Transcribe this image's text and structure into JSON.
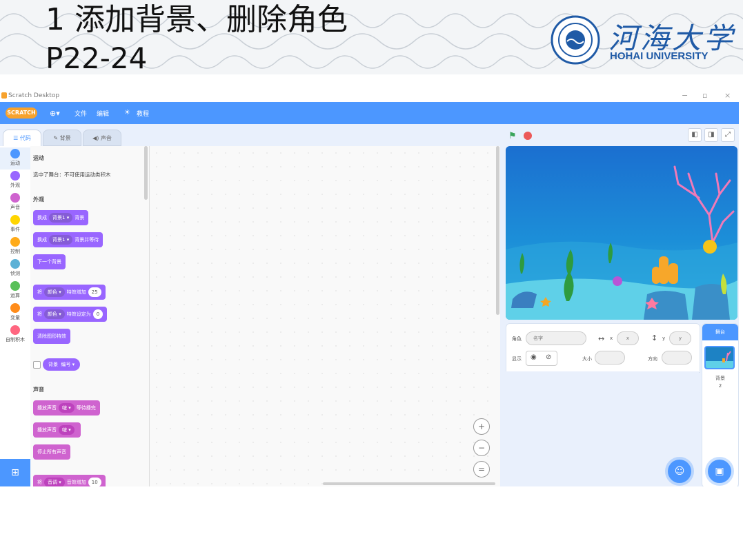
{
  "slide": {
    "title": "1 添加背景、删除角色",
    "subtitle": "P22-24",
    "university_cn": "河海大学",
    "university_en": "HOHAI UNIVERSITY"
  },
  "window": {
    "title": "Scratch Desktop",
    "min": "−",
    "max": "▫",
    "close": "×"
  },
  "menu": {
    "logo": "SCRATCH",
    "language_icon": "globe-icon",
    "file": "文件",
    "edit": "编辑",
    "tutorials": "教程"
  },
  "tabs": {
    "code": "代码",
    "backdrops": "背景",
    "sounds": "声音"
  },
  "categories": [
    {
      "label": "运动",
      "color": "#4c97ff"
    },
    {
      "label": "外观",
      "color": "#9966ff"
    },
    {
      "label": "声音",
      "color": "#cf63cf"
    },
    {
      "label": "事件",
      "color": "#ffd500"
    },
    {
      "label": "控制",
      "color": "#ffab19"
    },
    {
      "label": "侦测",
      "color": "#5cb1d6"
    },
    {
      "label": "运算",
      "color": "#59c059"
    },
    {
      "label": "变量",
      "color": "#ff8c1a"
    },
    {
      "label": "自制积木",
      "color": "#ff6680"
    }
  ],
  "palette": {
    "motion_heading": "运动",
    "motion_note": "选中了舞台：不可使用运动类积木",
    "looks_heading": "外观",
    "switch_backdrop": {
      "prefix": "换成",
      "value": "背景1",
      "suffix": "背景"
    },
    "switch_backdrop_wait": {
      "prefix": "换成",
      "value": "背景1",
      "suffix": "背景并等待"
    },
    "next_backdrop": "下一个背景",
    "change_effect": {
      "prefix": "将",
      "value": "颜色",
      "suffix": "特效增加",
      "num": "25"
    },
    "set_effect": {
      "prefix": "将",
      "value": "颜色",
      "suffix": "特效设定为",
      "num": "0"
    },
    "clear_effects": "清除图形特效",
    "backdrop_reporter": {
      "prefix": "背景",
      "value": "编号"
    },
    "sound_heading": "声音",
    "play_until_done": {
      "prefix": "播放声音",
      "value": "啵",
      "suffix": "等待播完"
    },
    "start_sound": {
      "prefix": "播放声音",
      "value": "啵"
    },
    "stop_all_sounds": "停止所有声音",
    "change_pitch": {
      "prefix": "将",
      "value": "音调",
      "suffix": "音效增加",
      "num": "10"
    }
  },
  "zoom": {
    "in": "+",
    "out": "−",
    "reset": "="
  },
  "sprite_info": {
    "sprite_label": "角色",
    "name_placeholder": "名字",
    "x_label": "x",
    "x_placeholder": "x",
    "y_label": "y",
    "y_placeholder": "y",
    "show_label": "显示",
    "size_label": "大小",
    "direction_label": "方向"
  },
  "stage_panel": {
    "header": "舞台",
    "backdrops_label": "背景",
    "backdrops_count": "2"
  }
}
